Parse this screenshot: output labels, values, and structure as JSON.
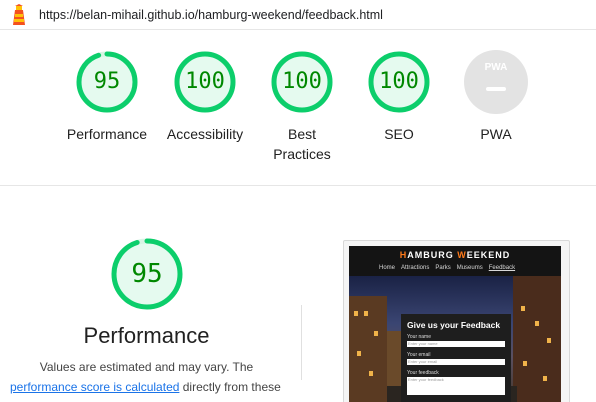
{
  "header": {
    "url": "https://belan-mihail.github.io/hamburg-weekend/feedback.html",
    "logo_icon": "lighthouse-icon"
  },
  "scores": [
    {
      "label": "Performance",
      "score": "95",
      "value": 95,
      "color": "#0cce6b"
    },
    {
      "label": "Accessibility",
      "score": "100",
      "value": 100,
      "color": "#0cce6b"
    },
    {
      "label": "Best Practices",
      "score": "100",
      "value": 100,
      "color": "#0cce6b"
    },
    {
      "label": "SEO",
      "score": "100",
      "value": 100,
      "color": "#0cce6b"
    }
  ],
  "pwa": {
    "label": "PWA",
    "badge_text": "PWA"
  },
  "performance_detail": {
    "score": "95",
    "value": 95,
    "title": "Performance",
    "line1": "Values are estimated and may vary. The",
    "link_text": "performance score is calculated",
    "line2_rest": " directly from these"
  },
  "thumbnail": {
    "logo_part1": "H",
    "logo_part2": "AMBURG ",
    "logo_part3": "W",
    "logo_part4": "EEKEND",
    "nav": [
      "Home",
      "Attractions",
      "Parks",
      "Museums",
      "Feedback"
    ],
    "form_title": "Give us your Feedback",
    "field_name_label": "Your name",
    "field_name_placeholder": "Enter your name",
    "field_email_label": "Your email",
    "field_email_placeholder": "Enter your email",
    "field_feedback_label": "Your feedback",
    "field_feedback_placeholder": "Enter your feedback"
  },
  "colors": {
    "pass": "#0cce6b",
    "pass_text": "#008800",
    "link": "#1a73e8"
  }
}
